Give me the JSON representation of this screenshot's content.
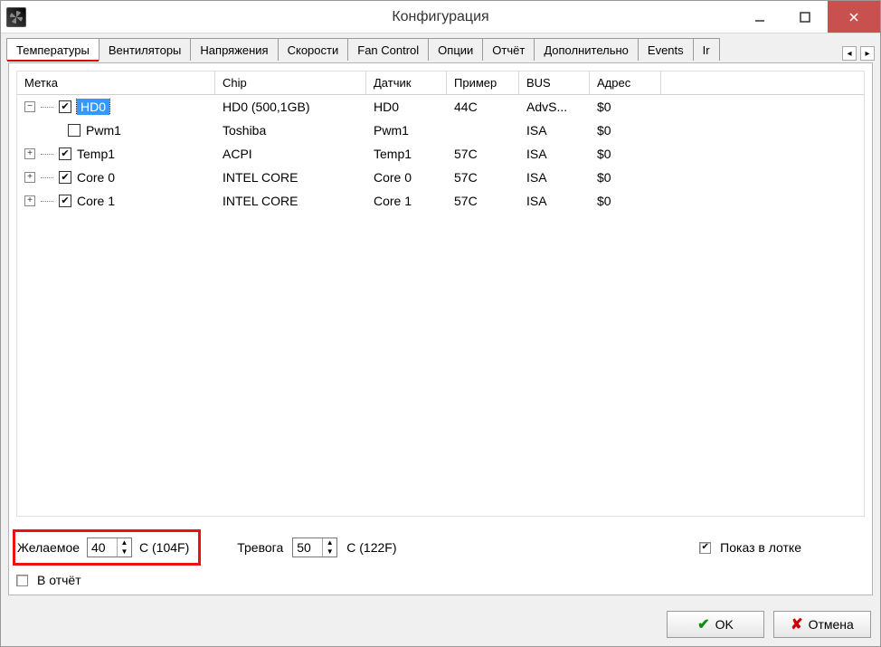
{
  "window": {
    "title": "Конфигурация"
  },
  "tabs": {
    "items": [
      "Температуры",
      "Вентиляторы",
      "Напряжения",
      "Скорости",
      "Fan Control",
      "Опции",
      "Отчёт",
      "Дополнительно",
      "Events",
      "Ir"
    ],
    "active_index": 0
  },
  "table": {
    "columns": [
      "Метка",
      "Chip",
      "Датчик",
      "Пример",
      "BUS",
      "Адрес"
    ],
    "rows": [
      {
        "indent": 0,
        "expander": "-",
        "checked": true,
        "selected": true,
        "label": "HD0",
        "chip": "HD0 (500,1GB)",
        "sensor": "HD0",
        "sample": "44C",
        "bus": "AdvS...",
        "address": "$0"
      },
      {
        "indent": 1,
        "expander": "",
        "checked": false,
        "selected": false,
        "label": "Pwm1",
        "chip": "Toshiba",
        "sensor": "Pwm1",
        "sample": "",
        "bus": "ISA",
        "address": "$0"
      },
      {
        "indent": 0,
        "expander": "+",
        "checked": true,
        "selected": false,
        "label": "Temp1",
        "chip": "ACPI",
        "sensor": "Temp1",
        "sample": "57C",
        "bus": "ISA",
        "address": "$0"
      },
      {
        "indent": 0,
        "expander": "+",
        "checked": true,
        "selected": false,
        "label": "Core 0",
        "chip": "INTEL CORE",
        "sensor": "Core 0",
        "sample": "57C",
        "bus": "ISA",
        "address": "$0"
      },
      {
        "indent": 0,
        "expander": "+",
        "checked": true,
        "selected": false,
        "label": "Core 1",
        "chip": "INTEL CORE",
        "sensor": "Core 1",
        "sample": "57C",
        "bus": "ISA",
        "address": "$0"
      }
    ]
  },
  "opts": {
    "desired_label": "Желаемое",
    "desired_value": "40",
    "desired_unit": "C (104F)",
    "alarm_label": "Тревога",
    "alarm_value": "50",
    "alarm_unit": "C (122F)",
    "tray_label": "Показ в лотке",
    "tray_checked": true,
    "report_label": "В отчёт",
    "report_checked": false
  },
  "buttons": {
    "ok": "OK",
    "cancel": "Отмена"
  }
}
